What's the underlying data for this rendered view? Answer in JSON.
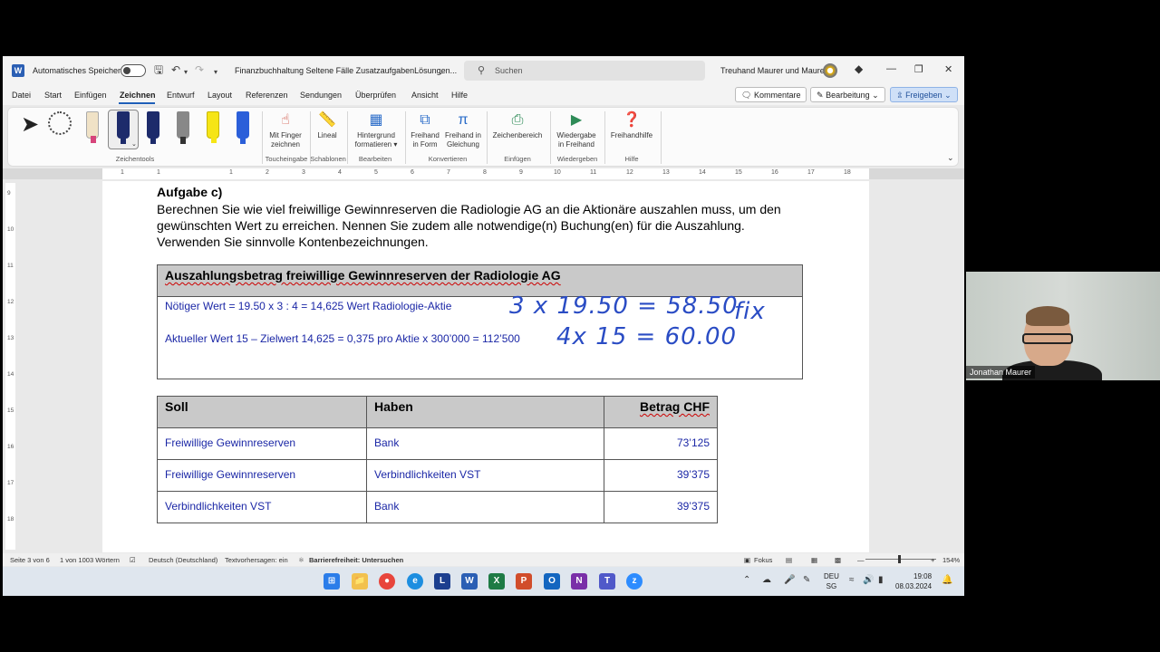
{
  "titlebar": {
    "app_logo": "W",
    "autosave_label": "Automatisches Speichern",
    "document_title": "Finanzbuchhaltung Seltene Fälle ZusatzaufgabenLösungen...",
    "search_placeholder": "Suchen",
    "org_name": "Treuhand Maurer und Maurer"
  },
  "menu": {
    "items": [
      "Datei",
      "Start",
      "Einfügen",
      "Zeichnen",
      "Entwurf",
      "Layout",
      "Referenzen",
      "Sendungen",
      "Überprüfen",
      "Ansicht",
      "Hilfe"
    ],
    "active": "Zeichnen",
    "comments_label": "Kommentare",
    "editing_label": "Bearbeitung",
    "share_label": "Freigeben"
  },
  "ribbon": {
    "group_drawing_tools": "Zeichentools",
    "btn_finger": [
      "Mit Finger",
      "zeichnen"
    ],
    "group_touch": "Toucheingabe",
    "btn_ruler": "Lineal",
    "group_templates": "Schablonen",
    "btn_background": [
      "Hintergrund",
      "formatieren"
    ],
    "group_edit": "Bearbeiten",
    "btn_freehand_shape": [
      "Freihand",
      "in Form"
    ],
    "btn_freehand_equation": [
      "Freihand in",
      "Gleichung"
    ],
    "group_convert": "Konvertieren",
    "btn_canvas": "Zeichenbereich",
    "group_insert": "Einfügen",
    "btn_replay": [
      "Wiedergabe",
      "in Freihand"
    ],
    "group_replay": "Wiedergeben",
    "btn_help": "Freihandhilfe",
    "group_help": "Hilfe",
    "pen_colors": [
      "#f2b8c6",
      "#1d2b6b",
      "#1d2b6b",
      "#555555",
      "#f6e516",
      "#2b5fd9"
    ]
  },
  "ruler": {
    "h_numbers": [
      "1",
      "2",
      "1",
      "1",
      "2",
      "3",
      "4",
      "5",
      "6",
      "7",
      "8",
      "9",
      "10",
      "11",
      "12",
      "13",
      "14",
      "15",
      "16",
      "17",
      "18"
    ],
    "v_numbers": [
      "9",
      "10",
      "11",
      "12",
      "13",
      "14",
      "15",
      "16",
      "17",
      "18"
    ]
  },
  "document": {
    "heading": "Aufgabe c)",
    "task_text": "Berechnen Sie wie viel freiwillige Gewinnreserven die Radiologie AG an die Aktionäre auszahlen muss, um den gewünschten Wert zu erreichen. Nennen Sie zudem alle notwendige(n) Buchung(en) für die Auszahlung. Verwenden Sie sinnvolle Kontenbezeichnungen.",
    "box_title": "Auszahlungsbetrag freiwillige Gewinnreserven der Radiologie AG",
    "calc_line1": "Nötiger Wert = 19.50 x 3 : 4 = 14,625 Wert Radiologie-Aktie",
    "calc_line2": "Aktueller Wert 15 – Zielwert 14,625 = 0,375 pro Aktie x 300’000 = 112’500",
    "handwriting_line1": "3 x 19.50 = 58.50",
    "handwriting_fix": "fix",
    "handwriting_line2": "4x 15 = 60.00",
    "journal": {
      "headers": [
        "Soll",
        "Haben",
        "Betrag CHF"
      ],
      "rows": [
        [
          "Freiwillige Gewinnreserven",
          "Bank",
          "73’125"
        ],
        [
          "Freiwillige Gewinnreserven",
          "Verbindlichkeiten VST",
          "39’375"
        ],
        [
          "Verbindlichkeiten VST",
          "Bank",
          "39’375"
        ]
      ]
    }
  },
  "statusbar": {
    "page": "Seite 3 von 6",
    "words": "1 von 1003 Wörtern",
    "language": "Deutsch (Deutschland)",
    "prediction": "Textvorhersagen: ein",
    "accessibility": "Barrierefreiheit: Untersuchen",
    "focus": "Fokus",
    "zoom": "154%"
  },
  "taskbar": {
    "lang_top": "DEU",
    "lang_bottom": "SG",
    "time": "19:08",
    "date": "08.03.2024"
  },
  "webcam": {
    "participant_name": "Jonathan Maurer"
  }
}
